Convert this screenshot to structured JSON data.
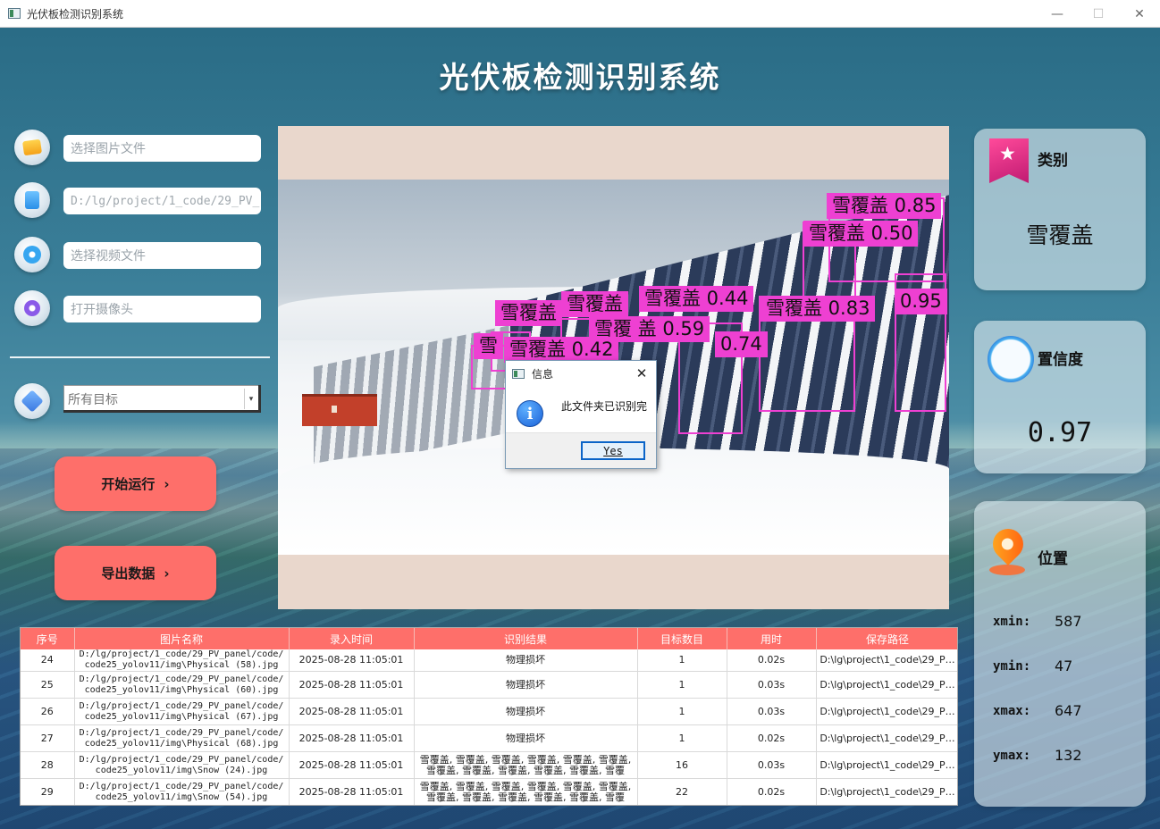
{
  "window": {
    "title": "光伏板检测识别系统",
    "controls": [
      "—",
      "☐",
      "✕"
    ]
  },
  "header": {
    "title": "光伏板检测识别系统"
  },
  "left_panel": {
    "image_input": {
      "placeholder": "选择图片文件",
      "icon": "image-folder-icon"
    },
    "folder_input": {
      "value": "D:/lg/project/1_code/29_PV_",
      "icon": "folder-file-icon"
    },
    "video_input": {
      "placeholder": "选择视频文件",
      "icon": "video-icon"
    },
    "camera_input": {
      "placeholder": "打开摄像头",
      "icon": "camera-icon"
    },
    "target_select": {
      "value": "所有目标",
      "arrow": "▾",
      "icon": "target-icon"
    },
    "start_button": {
      "label": "开始运行",
      "chevron": "›"
    },
    "export_button": {
      "label": "导出数据",
      "chevron": "›"
    }
  },
  "detections": [
    {
      "label": "雪覆盖 0.85"
    },
    {
      "label": "雪覆盖 0.50"
    },
    {
      "label": "雪覆盖 0.44"
    },
    {
      "label": "雪覆盖 0.83"
    },
    {
      "label": "0.95"
    },
    {
      "label": "雪覆盖"
    },
    {
      "label": "雪覆盖"
    },
    {
      "label": "雪覆 盖 0.59"
    },
    {
      "label": "雪覆盖 0.42"
    },
    {
      "label": "0.74"
    },
    {
      "label": "雪"
    }
  ],
  "dialog": {
    "title": "信息",
    "close": "✕",
    "info_glyph": "i",
    "message": "此文件夹已识别完",
    "yes_label": "Yes"
  },
  "result_cards": {
    "category": {
      "label": "类别",
      "value": "雪覆盖"
    },
    "confidence": {
      "label": "置信度",
      "value": "0.97"
    },
    "position": {
      "label": "位置",
      "xmin_label": "xmin:",
      "xmin": "587",
      "ymin_label": "ymin:",
      "ymin": "47",
      "xmax_label": "xmax:",
      "xmax": "647",
      "ymax_label": "ymax:",
      "ymax": "132"
    }
  },
  "table": {
    "columns": [
      "序号",
      "图片名称",
      "录入时间",
      "识别结果",
      "目标数目",
      "用时",
      "保存路径"
    ],
    "rows": [
      {
        "id": "24",
        "name": "D:/lg/project/1_code/29_PV_panel/code/code25_yolov11/img\\Physical (58).jpg",
        "time": "2025-08-28 11:05:01",
        "result": "物理损坏",
        "count": "1",
        "cost": "0.02s",
        "path": "D:\\lg\\project\\1_code\\29_P…"
      },
      {
        "id": "25",
        "name": "D:/lg/project/1_code/29_PV_panel/code/code25_yolov11/img\\Physical (60).jpg",
        "time": "2025-08-28 11:05:01",
        "result": "物理损坏",
        "count": "1",
        "cost": "0.03s",
        "path": "D:\\lg\\project\\1_code\\29_P…"
      },
      {
        "id": "26",
        "name": "D:/lg/project/1_code/29_PV_panel/code/code25_yolov11/img\\Physical (67).jpg",
        "time": "2025-08-28 11:05:01",
        "result": "物理损坏",
        "count": "1",
        "cost": "0.03s",
        "path": "D:\\lg\\project\\1_code\\29_P…"
      },
      {
        "id": "27",
        "name": "D:/lg/project/1_code/29_PV_panel/code/code25_yolov11/img\\Physical (68).jpg",
        "time": "2025-08-28 11:05:01",
        "result": "物理损坏",
        "count": "1",
        "cost": "0.02s",
        "path": "D:\\lg\\project\\1_code\\29_P…"
      },
      {
        "id": "28",
        "name": "D:/lg/project/1_code/29_PV_panel/code/code25_yolov11/img\\Snow (24).jpg",
        "time": "2025-08-28 11:05:01",
        "result": "雪覆盖, 雪覆盖, 雪覆盖, 雪覆盖, 雪覆盖, 雪覆盖, 雪覆盖, 雪覆盖, 雪覆盖, 雪覆盖, 雪覆盖, 雪覆盖…",
        "count": "16",
        "cost": "0.03s",
        "path": "D:\\lg\\project\\1_code\\29_P…"
      },
      {
        "id": "29",
        "name": "D:/lg/project/1_code/29_PV_panel/code/code25_yolov11/img\\Snow (54).jpg",
        "time": "2025-08-28 11:05:01",
        "result": "雪覆盖, 雪覆盖, 雪覆盖, 雪覆盖, 雪覆盖, 雪覆盖, 雪覆盖, 雪覆盖, 雪覆盖, 雪覆盖, 雪覆盖, 雪覆盖…",
        "count": "22",
        "cost": "0.02s",
        "path": "D:\\lg\\project\\1_code\\29_P…"
      }
    ]
  },
  "colors": {
    "accent": "#fe6f6a",
    "detection": "#ee40d2",
    "card_bg": "#e1ebf0"
  }
}
